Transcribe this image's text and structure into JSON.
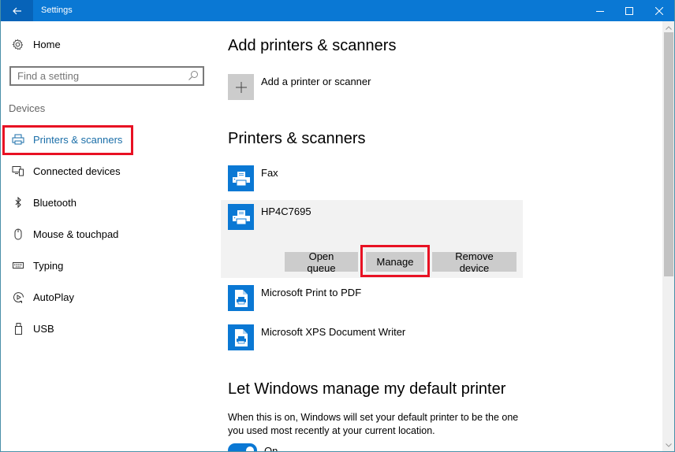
{
  "window": {
    "title": "Settings",
    "controls": {
      "minimize": "minimize",
      "maximize": "maximize",
      "close": "close"
    }
  },
  "sidebar": {
    "home_label": "Home",
    "search_placeholder": "Find a setting",
    "section_label": "Devices",
    "items": [
      {
        "label": "Printers & scanners",
        "icon": "printer-icon",
        "active": true
      },
      {
        "label": "Connected devices",
        "icon": "connected-devices-icon",
        "active": false
      },
      {
        "label": "Bluetooth",
        "icon": "bluetooth-icon",
        "active": false
      },
      {
        "label": "Mouse & touchpad",
        "icon": "mouse-icon",
        "active": false
      },
      {
        "label": "Typing",
        "icon": "keyboard-icon",
        "active": false
      },
      {
        "label": "AutoPlay",
        "icon": "autoplay-icon",
        "active": false
      },
      {
        "label": "USB",
        "icon": "usb-icon",
        "active": false
      }
    ]
  },
  "main": {
    "add_heading": "Add printers & scanners",
    "add_label": "Add a printer or scanner",
    "list_heading": "Printers & scanners",
    "devices": [
      {
        "name": "Fax",
        "icon": "printer-icon"
      },
      {
        "name": "HP4C7695",
        "icon": "printer-icon",
        "selected": true
      },
      {
        "name": "Microsoft Print to PDF",
        "icon": "document-printer-icon"
      },
      {
        "name": "Microsoft XPS Document Writer",
        "icon": "document-printer-icon"
      }
    ],
    "actions": {
      "open_queue": "Open queue",
      "manage": "Manage",
      "remove_device": "Remove device"
    },
    "default_heading": "Let Windows manage my default printer",
    "default_desc": "When this is on, Windows will set your default printer to be the one you used most recently at your current location.",
    "toggle_state": "On"
  },
  "colors": {
    "accent": "#0a78d4",
    "highlight": "#e81123",
    "button_bg": "#cccccc"
  }
}
